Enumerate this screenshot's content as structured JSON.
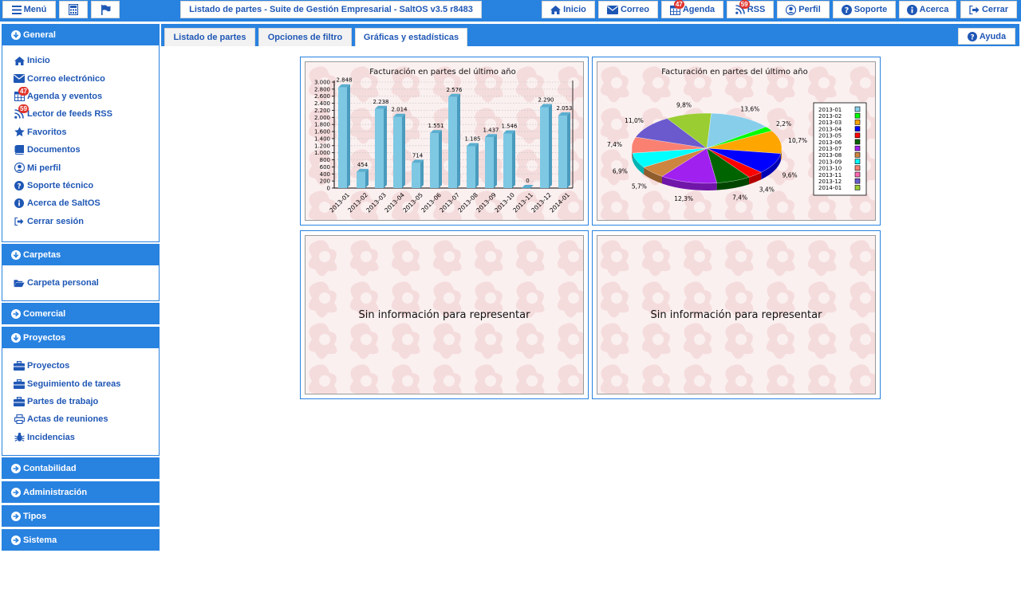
{
  "topbar": {
    "menu_label": "Menú",
    "window_title": "Listado de partes - Suite de Gestión Empresarial - SaltOS v3.5 r8483",
    "nav": [
      {
        "label": "Inicio",
        "icon": "home-icon"
      },
      {
        "label": "Correo",
        "icon": "envelope-icon"
      },
      {
        "label": "Agenda",
        "icon": "calendar-icon",
        "badge": "47"
      },
      {
        "label": "RSS",
        "icon": "rss-icon",
        "badge": "59"
      },
      {
        "label": "Perfil",
        "icon": "user-circle-icon"
      },
      {
        "label": "Soporte",
        "icon": "question-circle-icon"
      },
      {
        "label": "Acerca",
        "icon": "info-circle-icon"
      },
      {
        "label": "Cerrar",
        "icon": "sign-out-icon"
      }
    ]
  },
  "sidebar": {
    "general": {
      "title": "General",
      "items": [
        {
          "label": "Inicio",
          "icon": "home-icon"
        },
        {
          "label": "Correo electrónico",
          "icon": "envelope-icon"
        },
        {
          "label": "Agenda y eventos",
          "icon": "calendar-icon",
          "badge": "47"
        },
        {
          "label": "Lector de feeds RSS",
          "icon": "rss-icon",
          "badge": "59"
        },
        {
          "label": "Favoritos",
          "icon": "star-icon"
        },
        {
          "label": "Documentos",
          "icon": "book-icon"
        },
        {
          "label": "Mi perfil",
          "icon": "user-circle-icon"
        },
        {
          "label": "Soporte técnico",
          "icon": "question-circle-icon"
        },
        {
          "label": "Acerca de SaltOS",
          "icon": "info-circle-icon"
        },
        {
          "label": "Cerrar sesión",
          "icon": "sign-out-icon"
        }
      ]
    },
    "carpetas": {
      "title": "Carpetas",
      "items": [
        {
          "label": "Carpeta personal",
          "icon": "folder-open-icon"
        }
      ]
    },
    "comercial": {
      "title": "Comercial"
    },
    "proyectos": {
      "title": "Proyectos",
      "items": [
        {
          "label": "Proyectos",
          "icon": "briefcase-icon"
        },
        {
          "label": "Seguimiento de tareas",
          "icon": "briefcase-icon"
        },
        {
          "label": "Partes de trabajo",
          "icon": "briefcase-icon"
        },
        {
          "label": "Actas de reuniones",
          "icon": "print-icon"
        },
        {
          "label": "Incidencias",
          "icon": "bug-icon"
        }
      ]
    },
    "contabilidad": {
      "title": "Contabilidad"
    },
    "administracion": {
      "title": "Administración"
    },
    "tipos": {
      "title": "Tipos"
    },
    "sistema": {
      "title": "Sistema"
    }
  },
  "tabs": {
    "items": [
      "Listado de partes",
      "Opciones de filtro",
      "Gráficas y estadísticas"
    ],
    "active": 2,
    "help_label": "Ayuda"
  },
  "empty_panels": {
    "message": "Sin información para representar"
  },
  "colors": {
    "accent": "#2882e0",
    "link": "#1f57b5",
    "bar": "#7ec8e3",
    "badge": "#e0352d"
  },
  "chart_data": [
    {
      "type": "bar",
      "title": "Facturación en partes del último año",
      "categories": [
        "2013-01",
        "2013-02",
        "2013-03",
        "2013-04",
        "2013-05",
        "2013-06",
        "2013-07",
        "2013-08",
        "2013-09",
        "2013-10",
        "2013-11",
        "2013-12",
        "2014-01"
      ],
      "values": [
        2848,
        454,
        2238,
        2014,
        714,
        1551,
        2576,
        1185,
        1437,
        1546,
        0,
        2290,
        2053
      ],
      "value_labels": [
        "2.848",
        "454",
        "2.238",
        "2.014",
        "714",
        "1.551",
        "2.576",
        "1.185",
        "1.437",
        "1.546",
        "0",
        "2.290",
        "2.053"
      ],
      "y_ticks": [
        "3.000",
        "2.800",
        "2.600",
        "2.400",
        "2.200",
        "2.000",
        "1.800",
        "1.600",
        "1.400",
        "1.200",
        "1.000",
        "800",
        "600",
        "400",
        "200",
        "0"
      ],
      "ylim": [
        0,
        3000
      ],
      "grid": true
    },
    {
      "type": "pie",
      "title": "Facturación en partes del último año",
      "categories": [
        "2013-01",
        "2013-02",
        "2013-03",
        "2013-04",
        "2013-05",
        "2013-06",
        "2013-07",
        "2013-08",
        "2013-09",
        "2013-10",
        "2013-11",
        "2013-12",
        "2014-01"
      ],
      "values": [
        13.6,
        2.2,
        10.7,
        9.6,
        3.4,
        7.4,
        12.3,
        5.7,
        6.9,
        7.4,
        0.0,
        11.0,
        9.8
      ],
      "value_labels": [
        "13,6%",
        "2,2%",
        "10,7%",
        "9,6%",
        "3,4%",
        "7,4%",
        "12,3%",
        "5,7%",
        "6,9%",
        "7,4%",
        "",
        "11,0%",
        "9,8%"
      ],
      "colors": [
        "#87ceeb",
        "#00ff00",
        "#ffa500",
        "#0000ff",
        "#ff0000",
        "#006400",
        "#a020f0",
        "#cd853f",
        "#00ffff",
        "#fa8072",
        "#ff69b4",
        "#6a5acd",
        "#9acd32"
      ],
      "legend_position": "right"
    }
  ]
}
